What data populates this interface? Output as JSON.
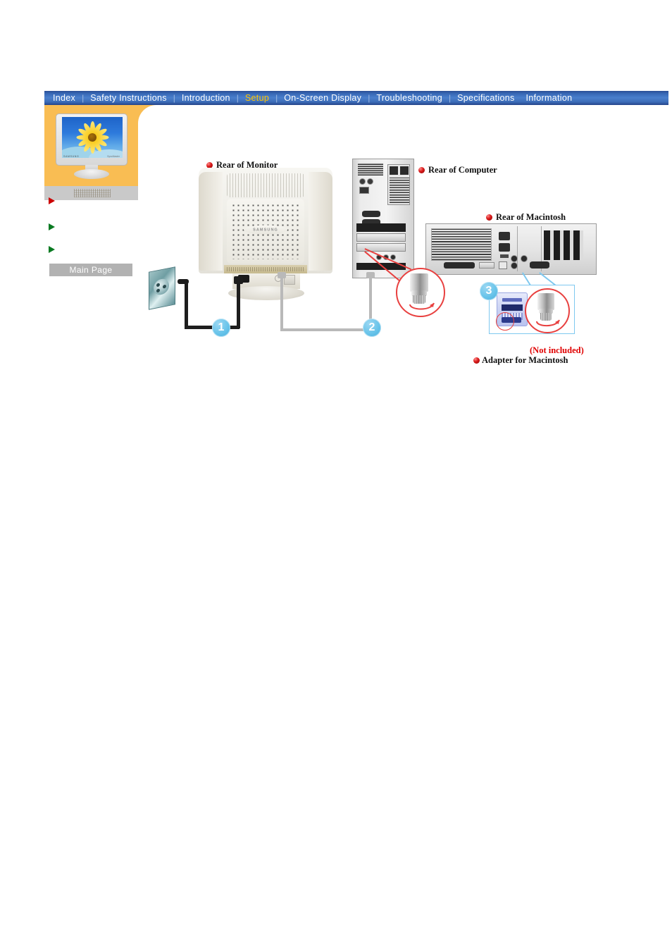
{
  "nav": {
    "items": [
      {
        "label": "Index",
        "active": false,
        "sep_after": true
      },
      {
        "label": "Safety Instructions",
        "active": false,
        "sep_after": true
      },
      {
        "label": "Introduction",
        "active": false,
        "sep_after": true
      },
      {
        "label": "Setup",
        "active": true,
        "sep_after": true
      },
      {
        "label": "On-Screen Display",
        "active": false,
        "sep_after": true
      },
      {
        "label": "Troubleshooting",
        "active": false,
        "sep_after": true
      },
      {
        "label": "Specifications",
        "active": false,
        "sep_after": false
      },
      {
        "label": "Information",
        "active": false,
        "sep_after": false
      }
    ],
    "separator": "|",
    "active_color": "#ffc400",
    "bar_color": "#3767b4",
    "text_color": "#ffffff"
  },
  "sidebar": {
    "panel_color": "#f9bd53",
    "caption_bar_color": "#c9c9c9",
    "thumbnail": {
      "brand": "SAMSUNG",
      "model": "SyncMaster",
      "alt": "monitor-thumbnail"
    },
    "bullets": [
      {
        "name": "bullet-red",
        "color": "#cc0000",
        "label": ""
      },
      {
        "name": "bullet-green-1",
        "color": "#0a7a22",
        "label": ""
      },
      {
        "name": "bullet-green-2",
        "color": "#0a7a22",
        "label": ""
      }
    ],
    "main_page_button": {
      "label": "Main Page",
      "bg": "#b2b2b2",
      "color": "#ffffff"
    }
  },
  "diagram": {
    "labels": {
      "rear_of_monitor": "Rear of Monitor",
      "rear_of_computer": "Rear of Computer",
      "rear_of_macintosh": "Rear of  Macintosh",
      "not_included": "(Not included)",
      "adapter_for_macintosh": "Adapter for Macintosh"
    },
    "bullet_color": "#d81717",
    "not_included_color": "#e00000",
    "steps": [
      {
        "number": "1",
        "name": "step-1-power-cable"
      },
      {
        "number": "2",
        "name": "step-2-signal-cable"
      },
      {
        "number": "3",
        "name": "step-3-macintosh-adapter"
      }
    ],
    "step_circle_color": "#69c4ea",
    "callout_circle_color": "#e8403f",
    "adapter_box_border_color": "#7ec8ef"
  }
}
